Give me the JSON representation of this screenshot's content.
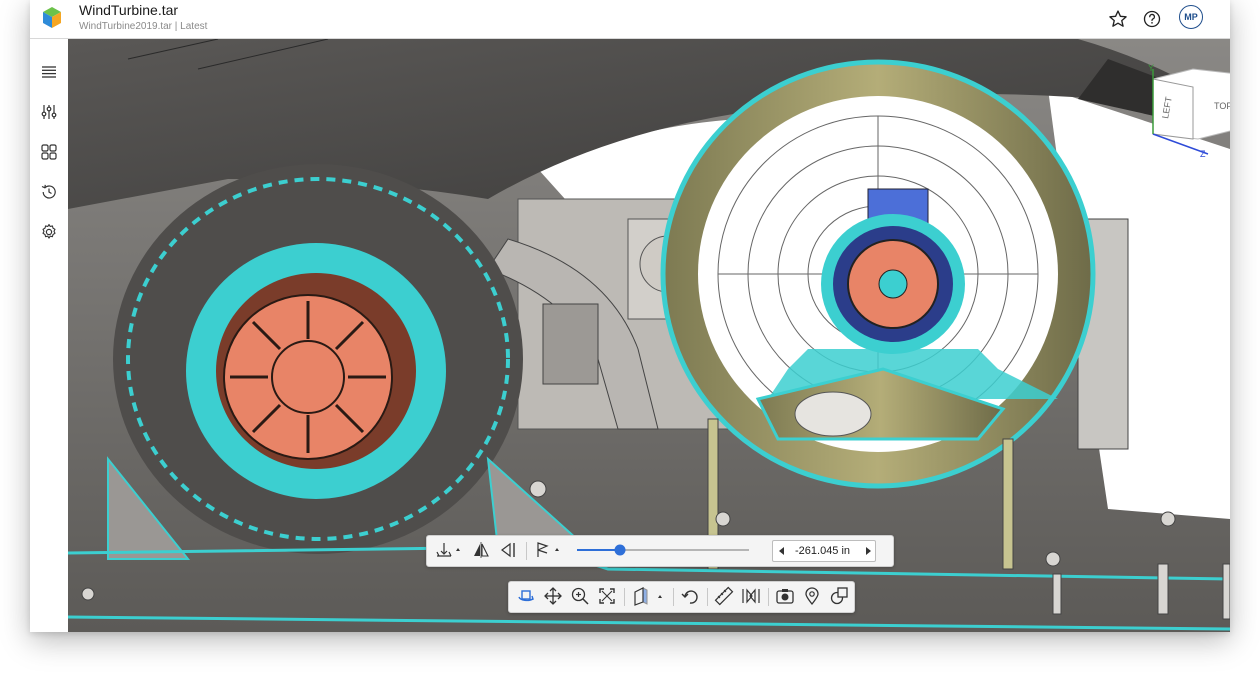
{
  "header": {
    "title": "WindTurbine.tar",
    "subtitle": "WindTurbine2019.tar | Latest",
    "favorite_icon": "star-outline-icon",
    "help_icon": "help-circle-icon",
    "user_initials": "MP"
  },
  "sidebar": {
    "items": [
      {
        "name": "model-tree",
        "icon": "list-icon"
      },
      {
        "name": "display-settings",
        "icon": "sliders-icon"
      },
      {
        "name": "views",
        "icon": "grid-icon"
      },
      {
        "name": "history",
        "icon": "history-icon"
      },
      {
        "name": "settings",
        "icon": "gear-icon"
      }
    ]
  },
  "view_cube": {
    "faces": [
      "LEFT",
      "TOP"
    ],
    "axes": [
      "Y",
      "Z"
    ]
  },
  "section_toolbar": {
    "offset_value": "-261.045 in",
    "slider_position": 0.25
  },
  "main_toolbar": {
    "tools": [
      "rotate",
      "pan",
      "zoom",
      "fit",
      "section",
      "undo",
      "measure",
      "explode",
      "screenshot",
      "pin",
      "shape"
    ]
  },
  "colors": {
    "accent": "#2e6fd8",
    "highlight": "#3ccfd0",
    "motor_core": "#e88467",
    "brand_blue": "#1f4e8c"
  }
}
